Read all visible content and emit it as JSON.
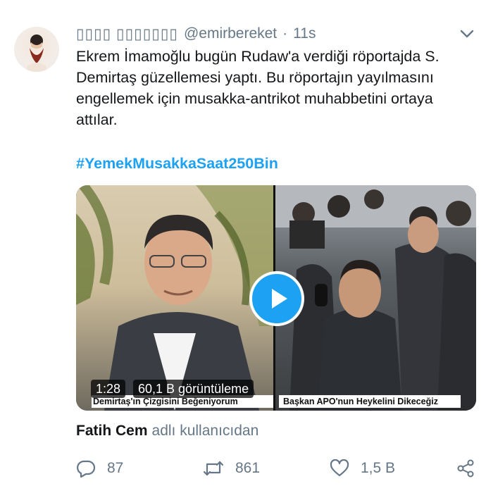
{
  "tweet": {
    "display_name": "▯▯▯▯ ▯▯▯▯▯▯▯",
    "handle": "@emirbereket",
    "separator": "·",
    "time": "11s",
    "text": "Ekrem İmamoğlu bugün Rudaw'a verdiği röportajda S. Demirtaş güzellemesi yaptı. Bu röportajın yayılmasını engellemek için musakka-antrikot muhabbetini ortaya attılar.",
    "hashtag": "#YemekMusakkaSaat250Bin"
  },
  "media": {
    "caption_left": "Demirtaş'ın Çizgisini Beğeniyorum",
    "caption_right": "Başkan APO'nun Heykelini Dikeceğiz",
    "duration": "1:28",
    "views": "60,1 B görüntüleme"
  },
  "attribution": {
    "name": "Fatih Cem",
    "suffix": "adlı kullanıcıdan"
  },
  "actions": {
    "replies": "87",
    "retweets": "861",
    "likes": "1,5 B"
  },
  "icons": {
    "caret": "chevron-down-icon",
    "reply": "reply-icon",
    "retweet": "retweet-icon",
    "like": "heart-icon",
    "share": "share-icon",
    "play": "play-icon"
  },
  "colors": {
    "accent": "#1da1f2",
    "text": "#14171a",
    "secondary": "#657786"
  }
}
